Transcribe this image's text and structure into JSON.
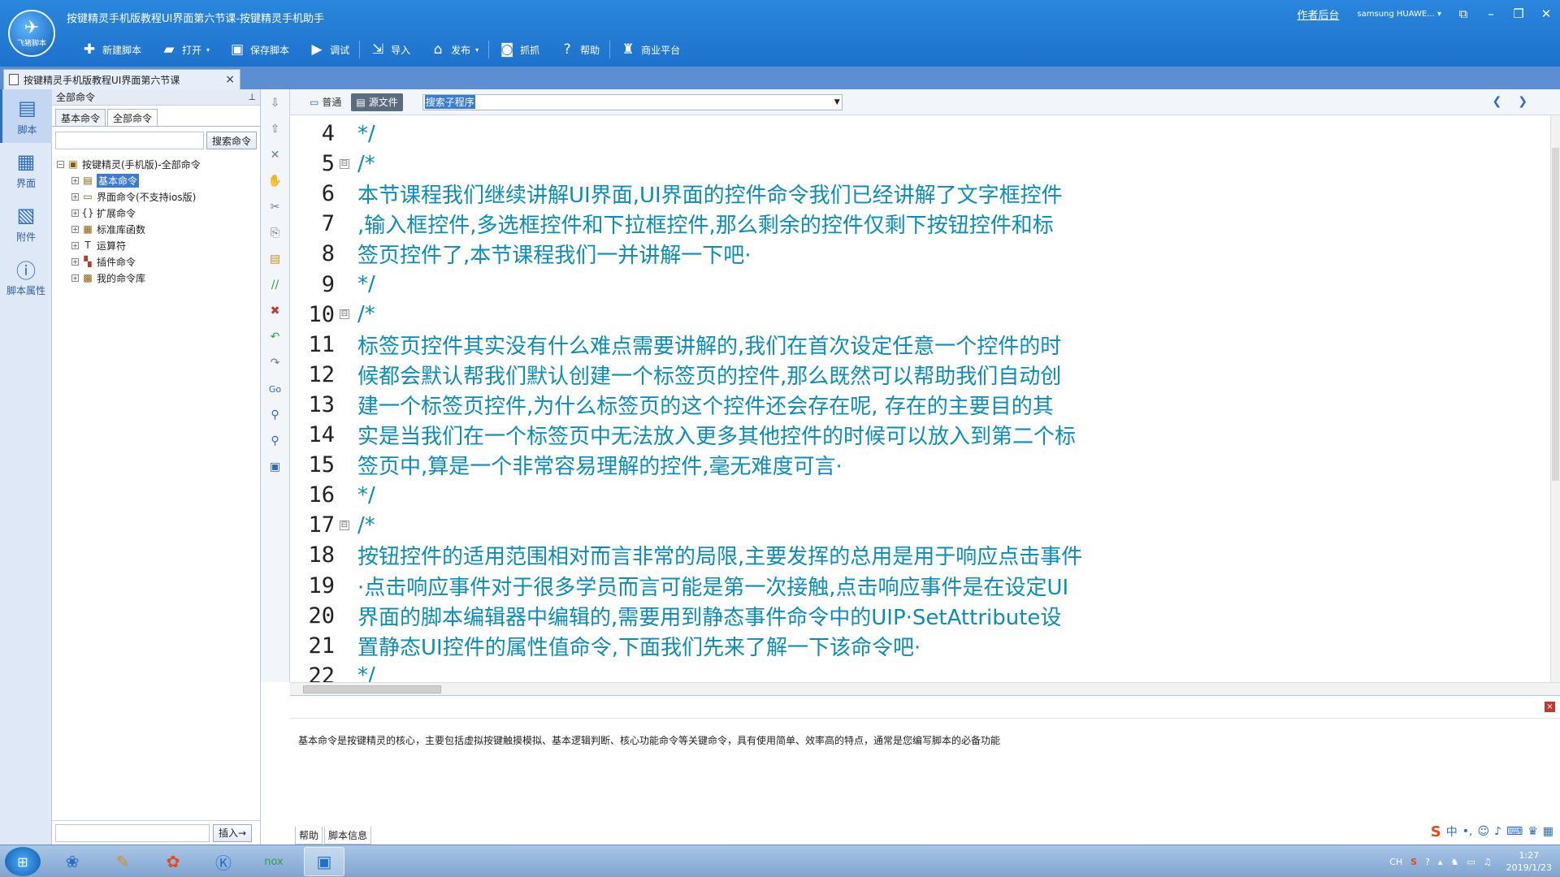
{
  "window": {
    "title": "按键精灵手机版教程UI界面第六节课-按键精灵手机助手",
    "logo_text": "飞猪脚本",
    "backend_link": "作者后台",
    "device": "samsung HUAWE..."
  },
  "toolbar": [
    {
      "label": "新建脚本",
      "icon": "plus-icon"
    },
    {
      "label": "打开",
      "icon": "folder-icon"
    },
    {
      "label": "保存脚本",
      "icon": "save-icon"
    },
    {
      "label": "调试",
      "icon": "play-icon"
    },
    {
      "label": "导入",
      "icon": "import-icon"
    },
    {
      "label": "发布",
      "icon": "publish-icon"
    },
    {
      "label": "抓抓",
      "icon": "camera-icon"
    },
    {
      "label": "帮助",
      "icon": "help-icon"
    },
    {
      "label": "商业平台",
      "icon": "bag-icon"
    }
  ],
  "doc_tab": {
    "label": "按键精灵手机版教程UI界面第六节课"
  },
  "leftnav": [
    {
      "label": "脚本",
      "icon": "script-icon",
      "active": true
    },
    {
      "label": "界面",
      "icon": "grid-icon",
      "active": false
    },
    {
      "label": "附件",
      "icon": "attachment-icon",
      "active": false
    },
    {
      "label": "脚本属性",
      "icon": "info-icon",
      "active": false
    }
  ],
  "command_panel": {
    "header": "全部命令",
    "tabs": [
      "基本命令",
      "全部命令"
    ],
    "search_button": "搜索命令",
    "insert_button": "插入→",
    "tree": {
      "root": "按键精灵(手机版)-全部命令",
      "children": [
        "基本命令",
        "界面命令(不支持ios版)",
        "扩展命令",
        "标准库函数",
        "运算符",
        "插件命令",
        "我的命令库"
      ]
    }
  },
  "editor": {
    "tabs": [
      "普通",
      "源文件"
    ],
    "active_tab": "源文件",
    "function_select": "搜索子程序",
    "lines": [
      {
        "n": "4",
        "fold": "",
        "text": "*/"
      },
      {
        "n": "5",
        "fold": "⊟",
        "text": "/*"
      },
      {
        "n": "6",
        "fold": "",
        "text": "本节课程我们继续讲解UI界面,UI界面的控件命令我们已经讲解了文字框控件"
      },
      {
        "n": "7",
        "fold": "",
        "text": ",输入框控件,多选框控件和下拉框控件,那么剩余的控件仅剩下按钮控件和标"
      },
      {
        "n": "8",
        "fold": "",
        "text": "签页控件了,本节课程我们一并讲解一下吧·"
      },
      {
        "n": "9",
        "fold": "",
        "text": "*/"
      },
      {
        "n": "10",
        "fold": "⊟",
        "text": "/*"
      },
      {
        "n": "11",
        "fold": "",
        "text": "标签页控件其实没有什么难点需要讲解的,我们在首次设定任意一个控件的时"
      },
      {
        "n": "12",
        "fold": "",
        "text": "候都会默认帮我们默认创建一个标签页的控件,那么既然可以帮助我们自动创"
      },
      {
        "n": "13",
        "fold": "",
        "text": "建一个标签页控件,为什么标签页的这个控件还会存在呢, 存在的主要目的其"
      },
      {
        "n": "14",
        "fold": "",
        "text": "实是当我们在一个标签页中无法放入更多其他控件的时候可以放入到第二个标"
      },
      {
        "n": "15",
        "fold": "",
        "text": "签页中,算是一个非常容易理解的控件,毫无难度可言·"
      },
      {
        "n": "16",
        "fold": "",
        "text": "*/"
      },
      {
        "n": "17",
        "fold": "⊟",
        "text": "/*"
      },
      {
        "n": "18",
        "fold": "",
        "text": "按钮控件的适用范围相对而言非常的局限,主要发挥的总用是用于响应点击事件"
      },
      {
        "n": "19",
        "fold": "",
        "text": "·点击响应事件对于很多学员而言可能是第一次接触,点击响应事件是在设定UI"
      },
      {
        "n": "20",
        "fold": "",
        "text": "界面的脚本编辑器中编辑的,需要用到静态事件命令中的UIP·SetAttribute设"
      },
      {
        "n": "21",
        "fold": "",
        "text": "置静态UI控件的属性值命令,下面我们先来了解一下该命令吧·"
      },
      {
        "n": "22",
        "fold": "",
        "text": "*/"
      }
    ]
  },
  "help_panel": {
    "text": "基本命令是按键精灵的核心，主要包括虚拟按键触摸模拟、基本逻辑判断、核心功能命令等关键命令，具有使用简单、效率高的特点，通常是您编写脚本的必备功能",
    "tabs": [
      "帮助",
      "脚本信息"
    ]
  },
  "taskbar": {
    "time": "1:27",
    "date": "2019/1/23",
    "lang": "CH"
  },
  "colors": {
    "titlebar": "#1e72cc",
    "code_text": "#0a8db8",
    "selection": "#3a7bd5"
  }
}
